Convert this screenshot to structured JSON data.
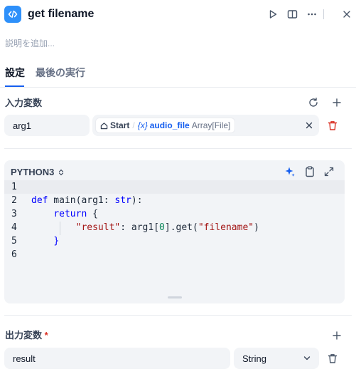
{
  "node": {
    "title": "get filename",
    "description_placeholder": "説明を追加..."
  },
  "header": {
    "icons": [
      "code-icon",
      "run-icon",
      "panel-icon",
      "more-icon",
      "close-icon"
    ]
  },
  "tabs": [
    {
      "label": "設定",
      "active": true
    },
    {
      "label": "最後の実行",
      "active": false
    }
  ],
  "input_vars": {
    "label": "入力変数",
    "items": [
      {
        "name": "arg1",
        "source_node": "Start",
        "separator": "/",
        "var_prefix": "{x}",
        "var_name": "audio_file",
        "var_type": "Array[File]"
      }
    ]
  },
  "editor": {
    "language": "PYTHON3",
    "line_numbers": [
      "1",
      "2",
      "3",
      "4",
      "5",
      "6"
    ],
    "code": {
      "l2_def": "def",
      "l2_rest": " main(arg1: ",
      "l2_type": "str",
      "l2_end": "):",
      "l3_return": "return",
      "l3_brace": " {",
      "l4_key": "\"result\"",
      "l4_colon": ": arg1[",
      "l4_idx": "0",
      "l4_mid": "].get(",
      "l4_arg": "\"filename\"",
      "l4_end": ")",
      "l5": "}"
    }
  },
  "output_vars": {
    "label": "出力変数",
    "required_mark": "*",
    "items": [
      {
        "name": "result",
        "type": "String"
      }
    ]
  },
  "colors": {
    "accent": "#155eef",
    "node_icon_bg": "#2e90fa",
    "delete": "#d92d20"
  }
}
